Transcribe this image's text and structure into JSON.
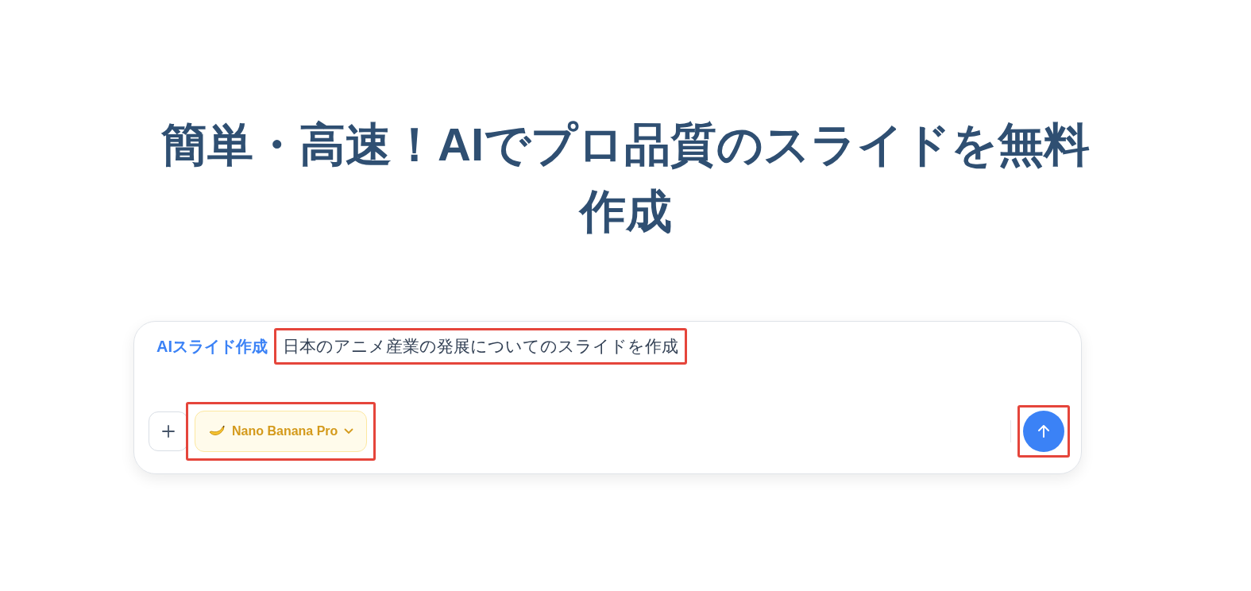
{
  "heading": "簡単・高速！AIでプロ品質のスライドを無料作成",
  "composer": {
    "label": "AIスライド作成",
    "prompt": {
      "value": "日本のアニメ産業の発展についてのスライドを作成",
      "highlighted": true
    },
    "model": {
      "label": "Nano Banana Pro",
      "highlighted": true
    },
    "send": {
      "highlighted": true
    }
  }
}
